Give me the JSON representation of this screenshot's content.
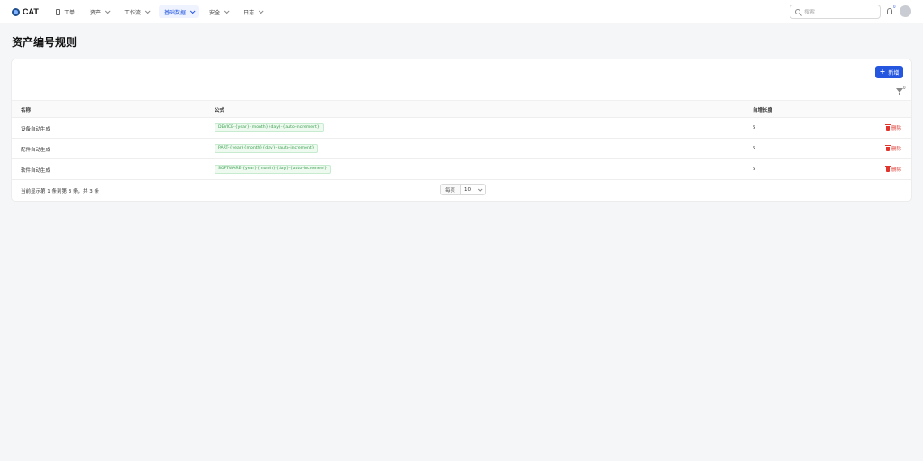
{
  "app": {
    "name": "CAT"
  },
  "nav": [
    {
      "label": "工单",
      "icon": "document-icon",
      "dropdown": false,
      "active": false
    },
    {
      "label": "资产",
      "dropdown": true,
      "active": false
    },
    {
      "label": "工作流",
      "dropdown": true,
      "active": false
    },
    {
      "label": "基础数据",
      "dropdown": true,
      "active": true
    },
    {
      "label": "安全",
      "dropdown": true,
      "active": false
    },
    {
      "label": "日志",
      "dropdown": true,
      "active": false
    }
  ],
  "search": {
    "placeholder": "搜索",
    "value": ""
  },
  "notifications": {
    "count": "0"
  },
  "page": {
    "title": "资产编号规则"
  },
  "toolbar": {
    "add_label": "新增",
    "filter_count": "0"
  },
  "table": {
    "columns": [
      "名称",
      "公式",
      "自增长度"
    ],
    "rows": [
      {
        "name": "设备自动生成",
        "formula": "DEVICE-{year}{month}{day}-{auto-increment}",
        "length": "5",
        "action": "删除"
      },
      {
        "name": "配件自动生成",
        "formula": "PART-{year}{month}{day}-{auto-increment}",
        "length": "5",
        "action": "删除"
      },
      {
        "name": "软件自动生成",
        "formula": "SOFTWARE-{year}{month}{day}-{auto-increment}",
        "length": "5",
        "action": "删除"
      }
    ]
  },
  "pagination": {
    "summary": "当前显示第 1 条到第 3 条，共 3 条",
    "per_page_label": "每页",
    "per_page_value": "10"
  },
  "colors": {
    "primary": "#2456e0",
    "danger": "#e0342c",
    "tag_green": "#3a9e4d",
    "background": "#f5f6f8"
  }
}
